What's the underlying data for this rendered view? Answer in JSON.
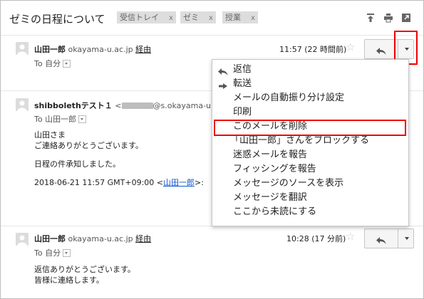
{
  "header": {
    "subject": "ゼミの日程について",
    "labels": [
      {
        "name": "受信トレイ",
        "close": "x"
      },
      {
        "name": "ゼミ",
        "close": "x"
      },
      {
        "name": "授業",
        "close": "x"
      }
    ],
    "icons": [
      "archive-icon",
      "print-icon",
      "new-window-icon"
    ]
  },
  "messages": [
    {
      "sender_name": "山田一郎",
      "sender_email": "okayama-u.ac.jp",
      "via": "経由",
      "to_label": "To 自分",
      "time": "11:57 (22 時間前)"
    },
    {
      "sender_name": "shibbolethテスト１",
      "email_prefix": "<",
      "email_suffix": "@s.okayama-u.ac",
      "to_label": "To 山田一郎",
      "lines": [
        "山田さま",
        "ご連絡ありがとうございます。",
        "日程の件承知しました。"
      ],
      "quote_prefix": "2018-06-21 11:57 GMT+09:00 <",
      "quote_link": "山田一郎",
      "quote_suffix": ">:"
    },
    {
      "sender_name": "山田一郎",
      "sender_email": "okayama-u.ac.jp",
      "via": "経由",
      "to_label": "To 自分",
      "time": "10:28 (17 分前)",
      "lines": [
        "返信ありがとうございます。",
        "皆様に連絡します。"
      ]
    }
  ],
  "menu": {
    "items": [
      {
        "label": "返信",
        "icon": "reply-icon"
      },
      {
        "label": "転送",
        "icon": "forward-icon"
      },
      {
        "label": "メールの自動振り分け設定"
      },
      {
        "label": "印刷"
      },
      {
        "label": "このメールを削除",
        "highlighted": true
      },
      {
        "label": "「山田一郎」さんをブロックする"
      },
      {
        "label": "迷惑メールを報告"
      },
      {
        "label": "フィッシングを報告"
      },
      {
        "label": "メッセージのソースを表示"
      },
      {
        "label": "メッセージを翻訳"
      },
      {
        "label": "ここから未読にする"
      }
    ]
  },
  "colors": {
    "highlight": "#e00000",
    "link": "#1155cc",
    "label_bg": "#dddddd"
  }
}
